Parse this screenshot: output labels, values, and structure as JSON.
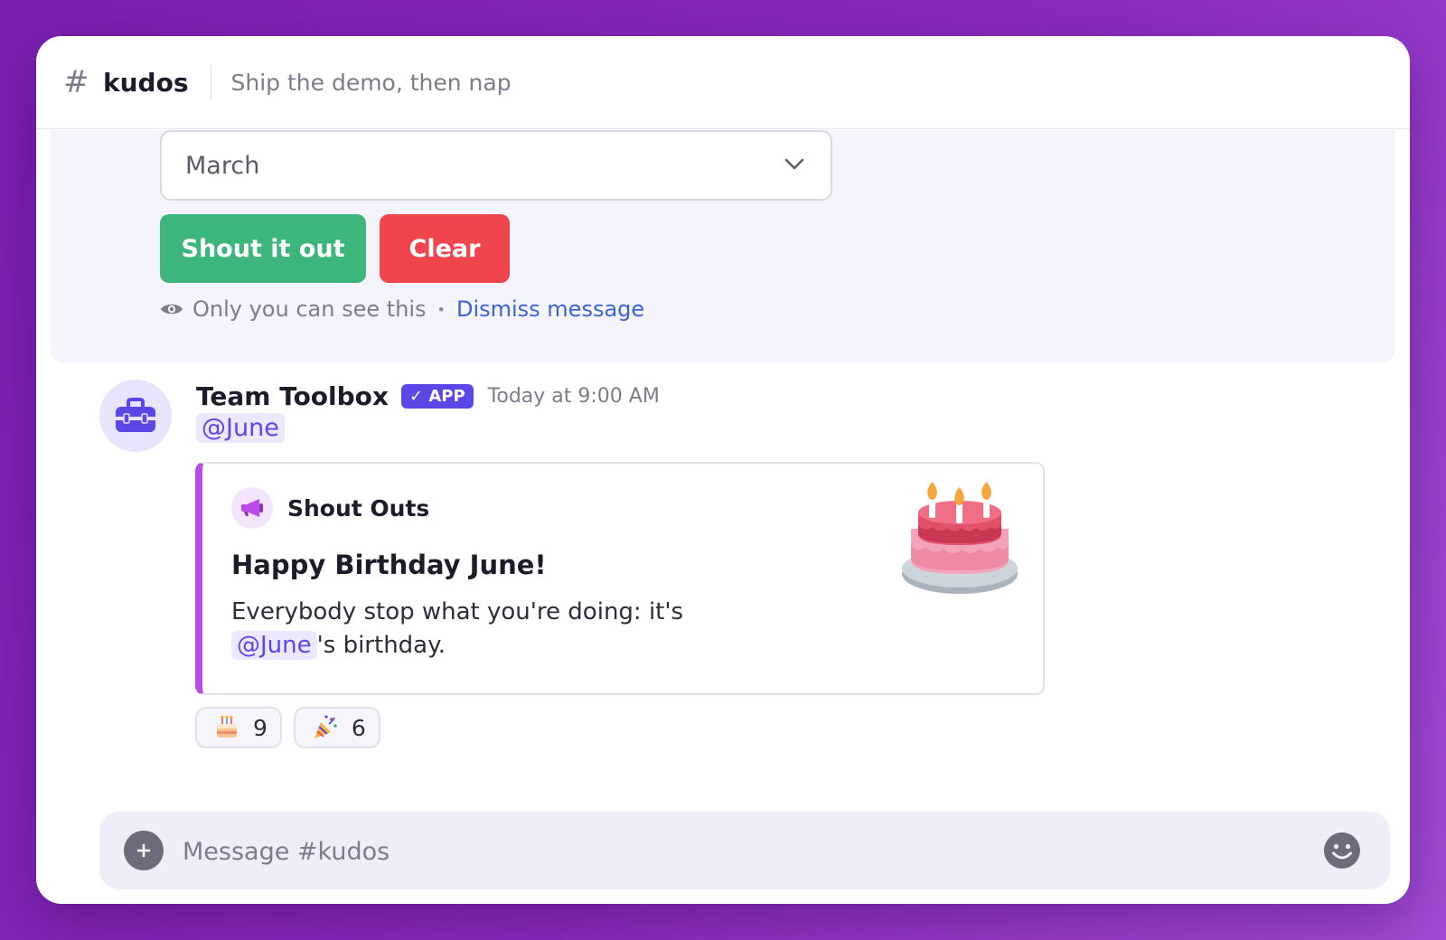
{
  "header": {
    "hash": "#",
    "channel": "kudos",
    "topic": "Ship the demo, then nap"
  },
  "ephemeral": {
    "select_value": "March",
    "shout_label": "Shout it out",
    "clear_label": "Clear",
    "visibility_text": "Only you can see this",
    "separator": "•",
    "dismiss_label": "Dismiss message"
  },
  "message": {
    "sender": "Team Toolbox",
    "badge": "✓ APP",
    "timestamp": "Today at 9:00 AM",
    "mention": "@June",
    "attachment": {
      "source": "Shout Outs",
      "title": "Happy Birthday June!",
      "body_before": "Everybody stop what you're doing: it's ",
      "body_mention": "@June",
      "body_after": "'s birthday."
    },
    "reactions": [
      {
        "icon": "cake-emoji",
        "count": "9"
      },
      {
        "icon": "party-popper-emoji",
        "count": "6"
      }
    ]
  },
  "composer": {
    "placeholder": "Message #kudos"
  },
  "colors": {
    "accent": "#5b46e6",
    "shout_button": "#3db67b",
    "clear_button": "#f0454c",
    "attachment_bar": "#b94be6",
    "link": "#3b63d6"
  }
}
